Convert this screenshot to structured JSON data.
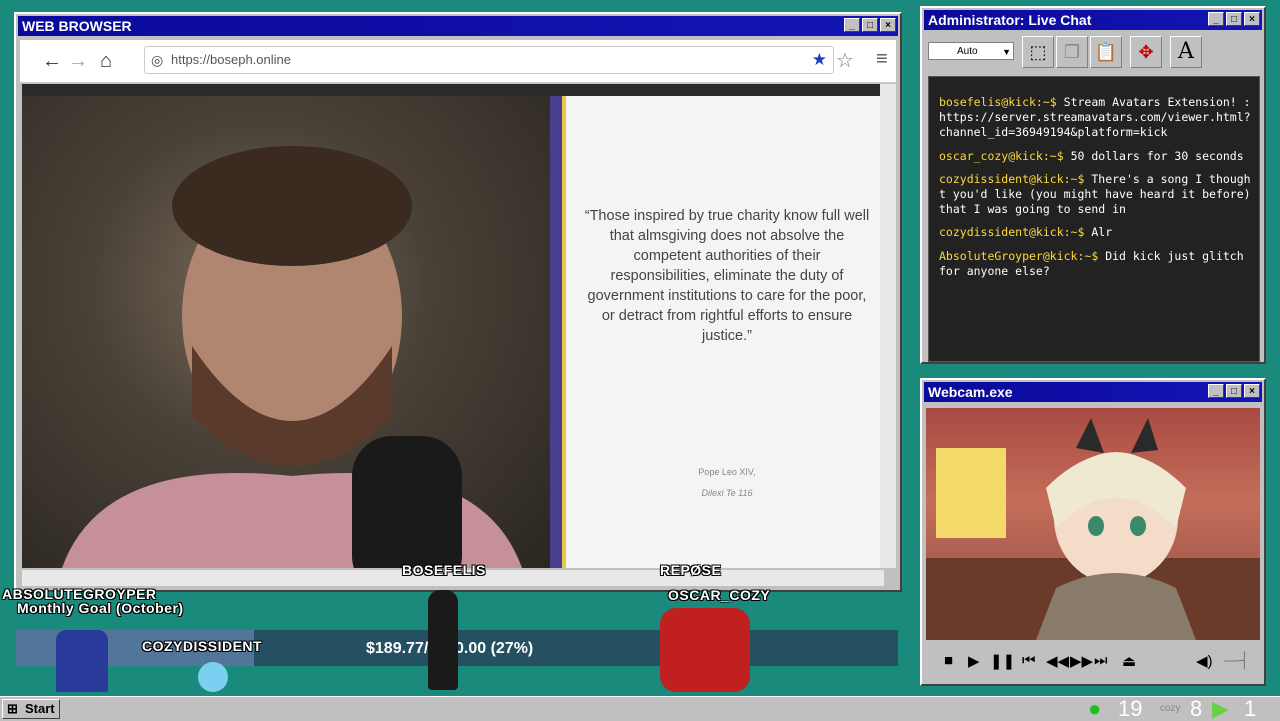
{
  "browser": {
    "title": "WEB BROWSER",
    "url": "https://boseph.online",
    "slide": {
      "quote": "“Those inspired by true charity know full well that almsgiving does not absolve the competent authorities of their responsibilities, eliminate the duty of government institutions to care for the poor, or detract from rightful efforts to ensure justice.”",
      "attribution_line1": "Pope Leo XIV,",
      "attribution_line2": "Dilexi Te 116"
    }
  },
  "chat": {
    "title": "Administrator: Live Chat",
    "zoom_select": "Auto",
    "messages": [
      {
        "user": "bosefelis@kick:~$",
        "text": "Stream Avatars Extension! : https://server.streamavatars.com/viewer.html?channel_id=36949194&platform=kick"
      },
      {
        "user": "oscar_cozy@kick:~$",
        "text": "50 dollars for 30 seconds"
      },
      {
        "user": "cozydissident@kick:~$",
        "text": "There's a song I thought you'd like (you might have heard it before) that I was going to send in"
      },
      {
        "user": "cozydissident@kick:~$",
        "text": "Alr"
      },
      {
        "user": "AbsoluteGroyper@kick:~$",
        "text": "Did kick just glitch for anyone else?"
      }
    ]
  },
  "webcam": {
    "title": "Webcam.exe"
  },
  "overlay": {
    "names": {
      "absolutegroyper": "ABSOLUTEGROYPER",
      "bosefelis": "BOSEFELIS",
      "repose": "REPØSE",
      "oscar_cozy": "OSCAR_COZY",
      "cozydissident": "COZYDISSIDENT"
    },
    "goal_label": "Monthly Goal (October)",
    "goal_text": "$189.77/$700.00 (27%)",
    "goal_fraction": 0.27
  },
  "taskbar": {
    "start_label": "Start",
    "viewers_kick": "19",
    "viewers_other": "8",
    "viewers_rumble": "1"
  }
}
